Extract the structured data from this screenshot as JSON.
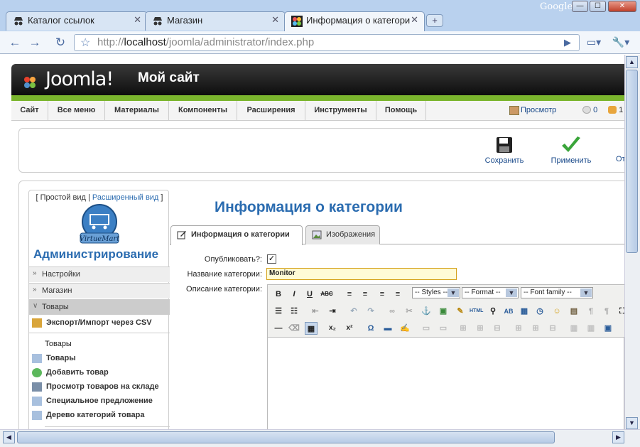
{
  "browser": {
    "brand": "Google",
    "tabs": [
      {
        "title": "Каталог ссылок",
        "icon": "incognito-icon"
      },
      {
        "title": "Магазин",
        "icon": "incognito-icon"
      },
      {
        "title": "Информация о категори",
        "icon": "joomla-icon"
      }
    ],
    "url_prefix": "http://",
    "url_host": "localhost",
    "url_path": "/joomla/administrator/index.php",
    "window_buttons": {
      "minimize": "—",
      "maximize": "☐",
      "close": "✕"
    }
  },
  "joomla": {
    "logo_text": "Joomla!",
    "site_name": "Мой сайт",
    "menu": [
      "Сайт",
      "Все меню",
      "Материалы",
      "Компоненты",
      "Расширения",
      "Инструменты",
      "Помощь"
    ],
    "preview_label": "Просмотр",
    "messages_count": "0",
    "users_count": "1",
    "toolbar": {
      "save": "Сохранить",
      "apply": "Применить",
      "other": "От"
    }
  },
  "virtuemart": {
    "view_simple": "Простой вид",
    "view_advanced": "Расширенный вид",
    "logo_label": "VirtueMart",
    "admin_title": "Администрирование",
    "sections": [
      "Настройки",
      "Магазин",
      "Товары"
    ],
    "export_link": "Экспорт/Импорт через CSV",
    "products_heading": "Товары",
    "product_links": [
      "Товары",
      "Добавить товар",
      "Просмотр товаров на складе",
      "Специальное предложение",
      "Дерево категорий товара"
    ]
  },
  "page": {
    "title": "Информация о категории",
    "tabs": [
      "Информация о категории",
      "Изображения"
    ],
    "published_label": "Опубликовать?:",
    "published_checked": true,
    "name_label": "Название категории:",
    "name_value": "Monitor",
    "desc_label": "Описание категории:"
  },
  "editor": {
    "styles_select": "-- Styles --",
    "format_select": "-- Format --",
    "font_select": "-- Font family --"
  }
}
